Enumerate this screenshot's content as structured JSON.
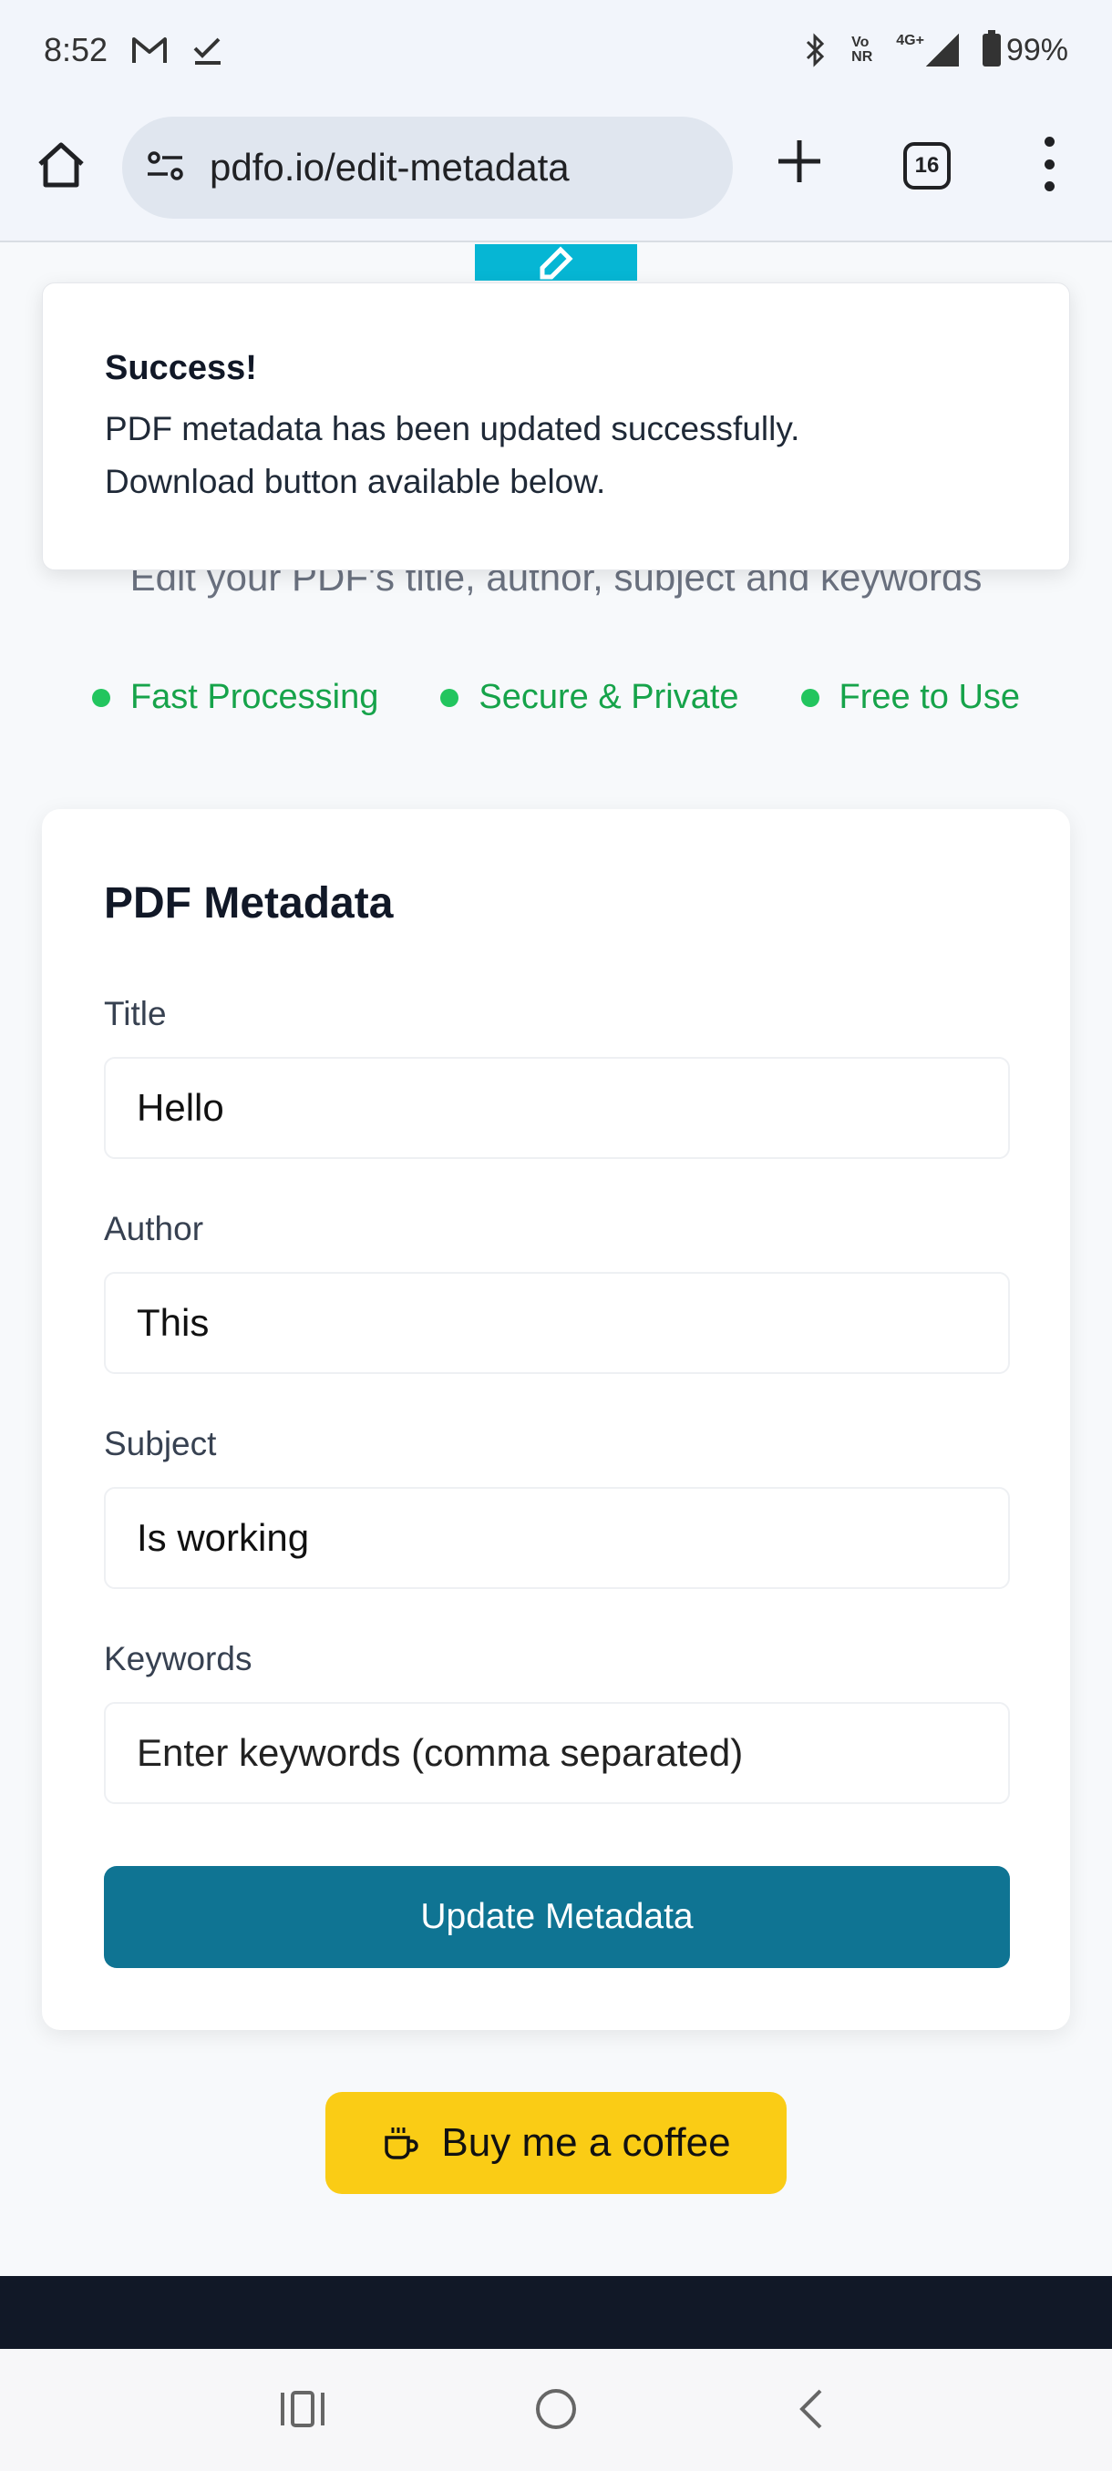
{
  "status_bar": {
    "time": "8:52",
    "network_top": "Vo",
    "network_bottom": "NR",
    "network_type": "4G+",
    "battery": "99%"
  },
  "browser": {
    "url": "pdfo.io/edit-metadata",
    "tab_count": "16"
  },
  "page": {
    "subtitle": "Edit your PDF's title, author, subject and keywords",
    "features": [
      "Fast Processing",
      "Secure & Private",
      "Free to Use"
    ]
  },
  "toast": {
    "title": "Success!",
    "message_line1": "PDF metadata has been updated successfully.",
    "message_line2": "Download button available below."
  },
  "form": {
    "heading": "PDF Metadata",
    "title_label": "Title",
    "title_value": "Hello",
    "author_label": "Author",
    "author_value": "This",
    "subject_label": "Subject",
    "subject_value": "Is working",
    "keywords_label": "Keywords",
    "keywords_placeholder": "Enter keywords (comma separated)",
    "submit_label": "Update Metadata"
  },
  "coffee": {
    "label": "Buy me a coffee"
  },
  "colors": {
    "accent": "#0f7493",
    "success": "#16a34a",
    "coffee": "#facc15",
    "brand": "#06b6d4"
  }
}
